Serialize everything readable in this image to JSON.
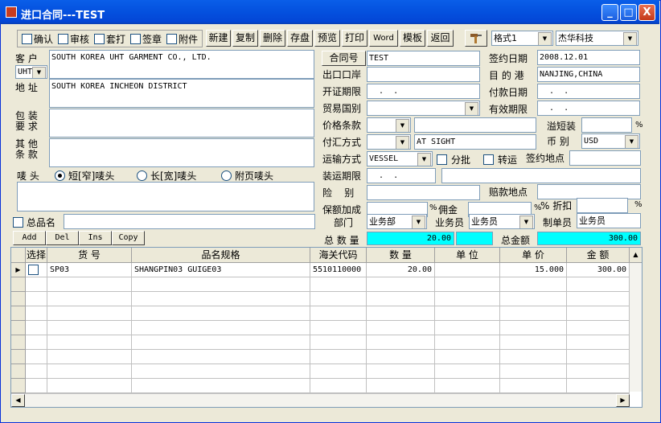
{
  "window": {
    "title": "进口合同---TEST",
    "min_label": "_",
    "max_label": "□",
    "close_label": "X"
  },
  "toolbar": {
    "checks": [
      "确认",
      "审核",
      "套打",
      "签章",
      "附件"
    ],
    "buttons": [
      "新建",
      "复制",
      "删除",
      "存盘",
      "预览",
      "打印",
      "Word",
      "模板",
      "返回"
    ],
    "format_value": "格式1",
    "company_value": "杰华科技"
  },
  "left": {
    "customer_label": "客 户",
    "customer_value": "SOUTH KOREA UHT GARMENT CO., LTD.",
    "uht_value": "UHT",
    "address_label": "地 址",
    "address_value": "SOUTH KOREA INCHEON DISTRICT",
    "packing_label1": "包 装",
    "packing_label2": "要 求",
    "other_label1": "其 他",
    "other_label2": "条 款",
    "mark_label": "唛 头",
    "radio1": "短[窄]唛头",
    "radio2": "长[宽]唛头",
    "radio3": "附页唛头",
    "total_name_label": "总品名",
    "grid_buttons": [
      "Add",
      "Del",
      "Ins",
      "Copy"
    ]
  },
  "middle": {
    "contract_no_btn": "合同号",
    "contract_no": "TEST",
    "export_port_label": "出口口岸",
    "lc_deadline_label": "开证期限",
    "lc_deadline_value": "  .  .",
    "trade_country_label": "贸易国别",
    "price_term_label": "价格条款",
    "payment_label": "付汇方式",
    "payment_value": "AT SIGHT",
    "transport_label": "运输方式",
    "transport_value": "VESSEL",
    "partial_label": "分批",
    "transship_label": "转运",
    "ship_deadline_label": "装运期限",
    "ship_deadline_value": "  .  .",
    "insurance_label": "险    别",
    "insurance_plus_label": "保额加成",
    "percent": "%",
    "commission_label": "佣金",
    "department_label": "部门",
    "department_value": "业务部",
    "salesman_label": "业务员",
    "salesman_value": "业务员",
    "total_qty_label": "总 数 量",
    "total_qty_value": "20.00"
  },
  "right": {
    "sign_date_label": "签约日期",
    "sign_date_value": "2008.12.01",
    "dest_port_label": "目 的 港",
    "dest_port_value": "NANJING,CHINA",
    "pay_date_label": "付款日期",
    "pay_date_value": "  .  .",
    "valid_label": "有效期限",
    "valid_value": "  .  .",
    "overflow_label": "溢短装",
    "currency_label": "币 别",
    "currency_value": "USD",
    "sign_place_label": "签约地点",
    "claim_place_label": "赔款地点",
    "discount_label": "折扣",
    "maker_label": "制单员",
    "maker_value": "业务员",
    "total_amount_label": "总金额",
    "total_amount_value": "300.00"
  },
  "table": {
    "columns": [
      "选择",
      "货 号",
      "品名规格",
      "海关代码",
      "数 量",
      "单 位",
      "单 价",
      "金 额"
    ],
    "rows": [
      {
        "item_no": "SP03",
        "spec": "SHANGPIN03 GUIGE03",
        "hs_code": "5510110000",
        "qty": "20.00",
        "unit": "",
        "price": "15.000",
        "amount": "300.00"
      }
    ]
  }
}
